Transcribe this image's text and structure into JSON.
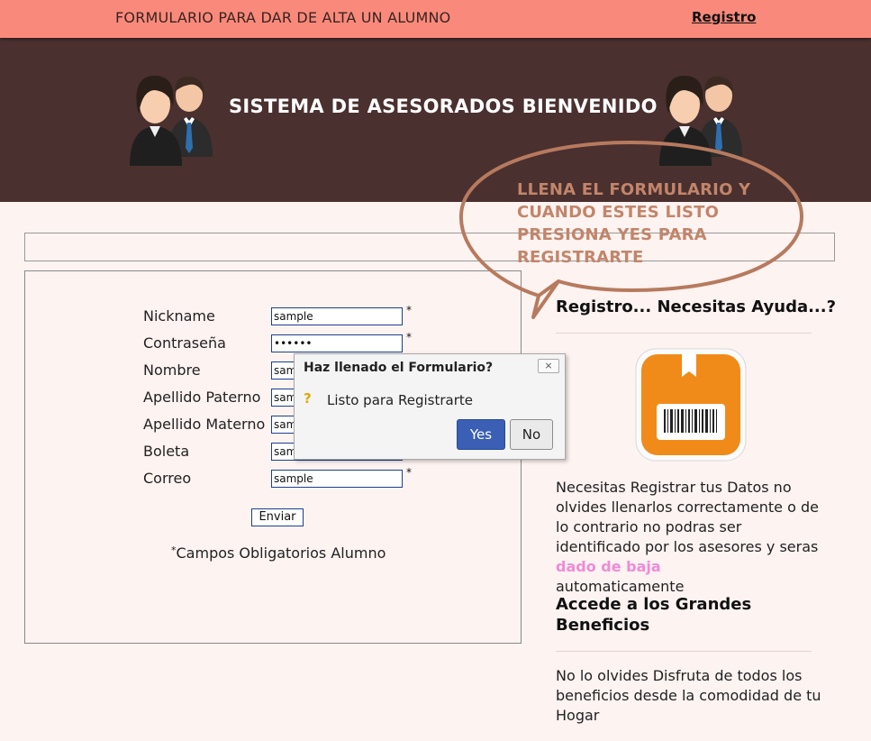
{
  "topbar": {
    "title": "FORMULARIO PARA DAR DE ALTA UN ALUMNO",
    "link": "Registro"
  },
  "header": {
    "welcome": "SISTEMA DE ASESORADOS BIENVENIDO"
  },
  "bubble": {
    "text": "LLENA EL FORMULARIO Y CUANDO ESTES LISTO PRESIONA YES PARA REGISTRARTE"
  },
  "form": {
    "fields": [
      {
        "label": "Nickname",
        "value": "sample",
        "required": "*"
      },
      {
        "label": "Contraseña",
        "value": "••••••",
        "required": "*"
      },
      {
        "label": "Nombre",
        "value": "sample"
      },
      {
        "label": "Apellido Paterno",
        "value": "sample"
      },
      {
        "label": "Apellido Materno",
        "value": "sample"
      },
      {
        "label": "Boleta",
        "value": "sample"
      },
      {
        "label": "Correo",
        "value": "sample",
        "required": "*"
      }
    ],
    "submit": "Enviar",
    "note_star": "*",
    "note": "Campos Obligatorios Alumno"
  },
  "dialog": {
    "title": "Haz llenado el Formulario?",
    "close": "×",
    "icon": "?",
    "message": "Listo para Registrarte",
    "yes": "Yes",
    "no": "No"
  },
  "sidebar": {
    "help_heading": "Registro... Necesitas Ayuda...?",
    "help_text_before": "Necesitas Registrar tus Datos no olvides llenarlos correctamente o de lo contrario no podras ser identificado por los asesores y seras ",
    "help_text_highlight": "dado de baja",
    "help_text_after": "automaticamente",
    "benefits_heading": "Accede a los Grandes Beneficios",
    "benefits_text": "No lo olvides Disfruta de todos los beneficios desde la comodidad de tu Hogar"
  },
  "colors": {
    "topbar": "#f98a7b",
    "header": "#4a302f",
    "bubble": "#b77a5e",
    "highlight": "#f08ad6",
    "button": "#3a5fb4"
  }
}
